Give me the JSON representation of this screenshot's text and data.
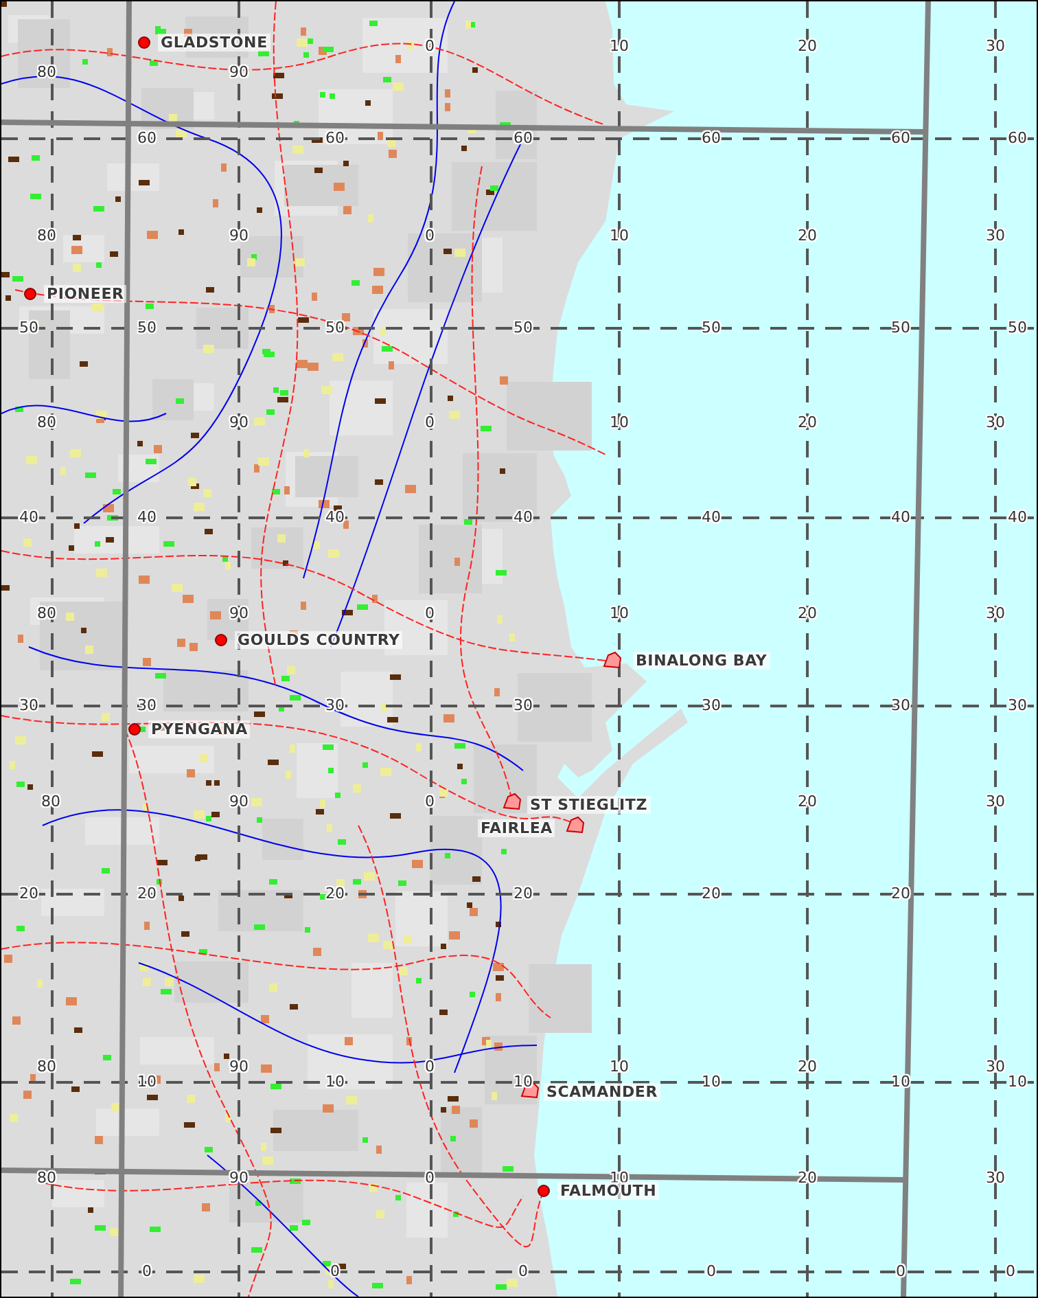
{
  "map": {
    "towns": [
      {
        "name": "GLADSTONE",
        "kind": "dot"
      },
      {
        "name": "PIONEER",
        "kind": "dot"
      },
      {
        "name": "GOULDS COUNTRY",
        "kind": "dot"
      },
      {
        "name": "PYENGANA",
        "kind": "dot"
      },
      {
        "name": "BINALONG BAY",
        "kind": "area"
      },
      {
        "name": "ST STIEGLITZ",
        "kind": "area"
      },
      {
        "name": "FAIRLEA",
        "kind": "area"
      },
      {
        "name": "SCAMANDER",
        "kind": "area"
      },
      {
        "name": "FALMOUTH",
        "kind": "dot"
      }
    ],
    "grid_label_rows": [
      [
        "80",
        "90",
        "0",
        "10",
        "20",
        "30"
      ],
      [
        "60",
        "60",
        "60",
        "60",
        "60",
        "60"
      ],
      [
        "80",
        "90",
        "0",
        "10",
        "20",
        "30"
      ],
      [
        "50",
        "50",
        "50",
        "50",
        "50",
        "50",
        "50"
      ],
      [
        "80",
        "90",
        "0",
        "10",
        "20",
        "30"
      ],
      [
        "40",
        "40",
        "40",
        "40",
        "40",
        "40",
        "40"
      ],
      [
        "80",
        "90",
        "0",
        "10",
        "20",
        "30"
      ],
      [
        "30",
        "30",
        "30",
        "30",
        "30",
        "30",
        "30"
      ],
      [
        "80",
        "90",
        "0",
        "20",
        "30"
      ],
      [
        "20",
        "20",
        "20",
        "20",
        "20",
        "20"
      ],
      [
        "80",
        "90",
        "0",
        "10",
        "20",
        "30"
      ],
      [
        "10",
        "10",
        "10",
        "10",
        "10",
        "10"
      ],
      [
        "80",
        "90",
        "0",
        "10",
        "20",
        "30"
      ],
      [
        "0",
        "0",
        "0",
        "0",
        "0",
        "0"
      ]
    ]
  }
}
